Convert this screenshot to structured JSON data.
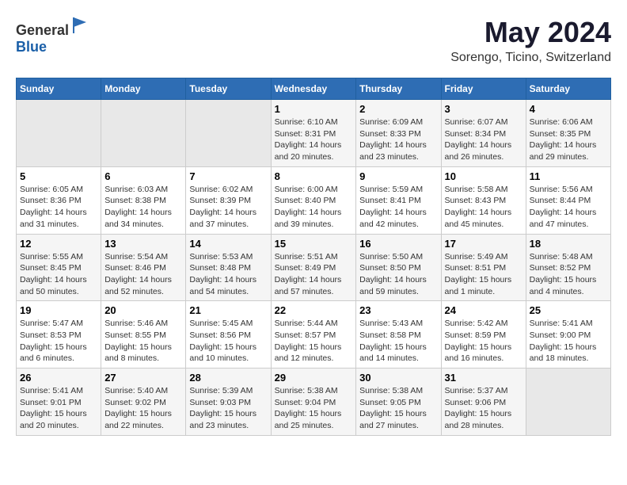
{
  "header": {
    "logo_general": "General",
    "logo_blue": "Blue",
    "month": "May 2024",
    "location": "Sorengo, Ticino, Switzerland"
  },
  "weekdays": [
    "Sunday",
    "Monday",
    "Tuesday",
    "Wednesday",
    "Thursday",
    "Friday",
    "Saturday"
  ],
  "weeks": [
    [
      {
        "day": "",
        "info": ""
      },
      {
        "day": "",
        "info": ""
      },
      {
        "day": "",
        "info": ""
      },
      {
        "day": "1",
        "info": "Sunrise: 6:10 AM\nSunset: 8:31 PM\nDaylight: 14 hours\nand 20 minutes."
      },
      {
        "day": "2",
        "info": "Sunrise: 6:09 AM\nSunset: 8:33 PM\nDaylight: 14 hours\nand 23 minutes."
      },
      {
        "day": "3",
        "info": "Sunrise: 6:07 AM\nSunset: 8:34 PM\nDaylight: 14 hours\nand 26 minutes."
      },
      {
        "day": "4",
        "info": "Sunrise: 6:06 AM\nSunset: 8:35 PM\nDaylight: 14 hours\nand 29 minutes."
      }
    ],
    [
      {
        "day": "5",
        "info": "Sunrise: 6:05 AM\nSunset: 8:36 PM\nDaylight: 14 hours\nand 31 minutes."
      },
      {
        "day": "6",
        "info": "Sunrise: 6:03 AM\nSunset: 8:38 PM\nDaylight: 14 hours\nand 34 minutes."
      },
      {
        "day": "7",
        "info": "Sunrise: 6:02 AM\nSunset: 8:39 PM\nDaylight: 14 hours\nand 37 minutes."
      },
      {
        "day": "8",
        "info": "Sunrise: 6:00 AM\nSunset: 8:40 PM\nDaylight: 14 hours\nand 39 minutes."
      },
      {
        "day": "9",
        "info": "Sunrise: 5:59 AM\nSunset: 8:41 PM\nDaylight: 14 hours\nand 42 minutes."
      },
      {
        "day": "10",
        "info": "Sunrise: 5:58 AM\nSunset: 8:43 PM\nDaylight: 14 hours\nand 45 minutes."
      },
      {
        "day": "11",
        "info": "Sunrise: 5:56 AM\nSunset: 8:44 PM\nDaylight: 14 hours\nand 47 minutes."
      }
    ],
    [
      {
        "day": "12",
        "info": "Sunrise: 5:55 AM\nSunset: 8:45 PM\nDaylight: 14 hours\nand 50 minutes."
      },
      {
        "day": "13",
        "info": "Sunrise: 5:54 AM\nSunset: 8:46 PM\nDaylight: 14 hours\nand 52 minutes."
      },
      {
        "day": "14",
        "info": "Sunrise: 5:53 AM\nSunset: 8:48 PM\nDaylight: 14 hours\nand 54 minutes."
      },
      {
        "day": "15",
        "info": "Sunrise: 5:51 AM\nSunset: 8:49 PM\nDaylight: 14 hours\nand 57 minutes."
      },
      {
        "day": "16",
        "info": "Sunrise: 5:50 AM\nSunset: 8:50 PM\nDaylight: 14 hours\nand 59 minutes."
      },
      {
        "day": "17",
        "info": "Sunrise: 5:49 AM\nSunset: 8:51 PM\nDaylight: 15 hours\nand 1 minute."
      },
      {
        "day": "18",
        "info": "Sunrise: 5:48 AM\nSunset: 8:52 PM\nDaylight: 15 hours\nand 4 minutes."
      }
    ],
    [
      {
        "day": "19",
        "info": "Sunrise: 5:47 AM\nSunset: 8:53 PM\nDaylight: 15 hours\nand 6 minutes."
      },
      {
        "day": "20",
        "info": "Sunrise: 5:46 AM\nSunset: 8:55 PM\nDaylight: 15 hours\nand 8 minutes."
      },
      {
        "day": "21",
        "info": "Sunrise: 5:45 AM\nSunset: 8:56 PM\nDaylight: 15 hours\nand 10 minutes."
      },
      {
        "day": "22",
        "info": "Sunrise: 5:44 AM\nSunset: 8:57 PM\nDaylight: 15 hours\nand 12 minutes."
      },
      {
        "day": "23",
        "info": "Sunrise: 5:43 AM\nSunset: 8:58 PM\nDaylight: 15 hours\nand 14 minutes."
      },
      {
        "day": "24",
        "info": "Sunrise: 5:42 AM\nSunset: 8:59 PM\nDaylight: 15 hours\nand 16 minutes."
      },
      {
        "day": "25",
        "info": "Sunrise: 5:41 AM\nSunset: 9:00 PM\nDaylight: 15 hours\nand 18 minutes."
      }
    ],
    [
      {
        "day": "26",
        "info": "Sunrise: 5:41 AM\nSunset: 9:01 PM\nDaylight: 15 hours\nand 20 minutes."
      },
      {
        "day": "27",
        "info": "Sunrise: 5:40 AM\nSunset: 9:02 PM\nDaylight: 15 hours\nand 22 minutes."
      },
      {
        "day": "28",
        "info": "Sunrise: 5:39 AM\nSunset: 9:03 PM\nDaylight: 15 hours\nand 23 minutes."
      },
      {
        "day": "29",
        "info": "Sunrise: 5:38 AM\nSunset: 9:04 PM\nDaylight: 15 hours\nand 25 minutes."
      },
      {
        "day": "30",
        "info": "Sunrise: 5:38 AM\nSunset: 9:05 PM\nDaylight: 15 hours\nand 27 minutes."
      },
      {
        "day": "31",
        "info": "Sunrise: 5:37 AM\nSunset: 9:06 PM\nDaylight: 15 hours\nand 28 minutes."
      },
      {
        "day": "",
        "info": ""
      }
    ]
  ]
}
